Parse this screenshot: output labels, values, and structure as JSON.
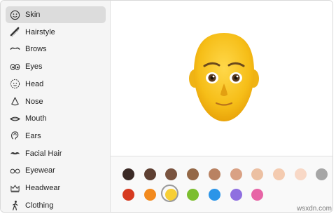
{
  "sidebar": {
    "items": [
      {
        "label": "Skin",
        "icon": "smiley-icon",
        "selected": true
      },
      {
        "label": "Hairstyle",
        "icon": "comb-icon"
      },
      {
        "label": "Brows",
        "icon": "brows-icon"
      },
      {
        "label": "Eyes",
        "icon": "eyes-icon"
      },
      {
        "label": "Head",
        "icon": "head-icon"
      },
      {
        "label": "Nose",
        "icon": "nose-icon"
      },
      {
        "label": "Mouth",
        "icon": "mouth-icon"
      },
      {
        "label": "Ears",
        "icon": "ear-icon"
      },
      {
        "label": "Facial Hair",
        "icon": "mustache-icon"
      },
      {
        "label": "Eyewear",
        "icon": "glasses-icon"
      },
      {
        "label": "Headwear",
        "icon": "crown-icon"
      },
      {
        "label": "Clothing",
        "icon": "figure-icon"
      }
    ]
  },
  "palette": {
    "row1": [
      "#3b2a26",
      "#5e3f32",
      "#7a5440",
      "#946847",
      "#b98262",
      "#d9a184",
      "#ecc0a2",
      "#f4cbb0",
      "#f8d8c6",
      "#a6a6a6"
    ],
    "row2": [
      "#d63a20",
      "#f28a1e",
      "#f7cf36",
      "#7cbe2f",
      "#2b95e8",
      "#8f6fe0",
      "#e765a6"
    ],
    "selected_row2_index": 2
  },
  "watermark": "wsxdn.com"
}
